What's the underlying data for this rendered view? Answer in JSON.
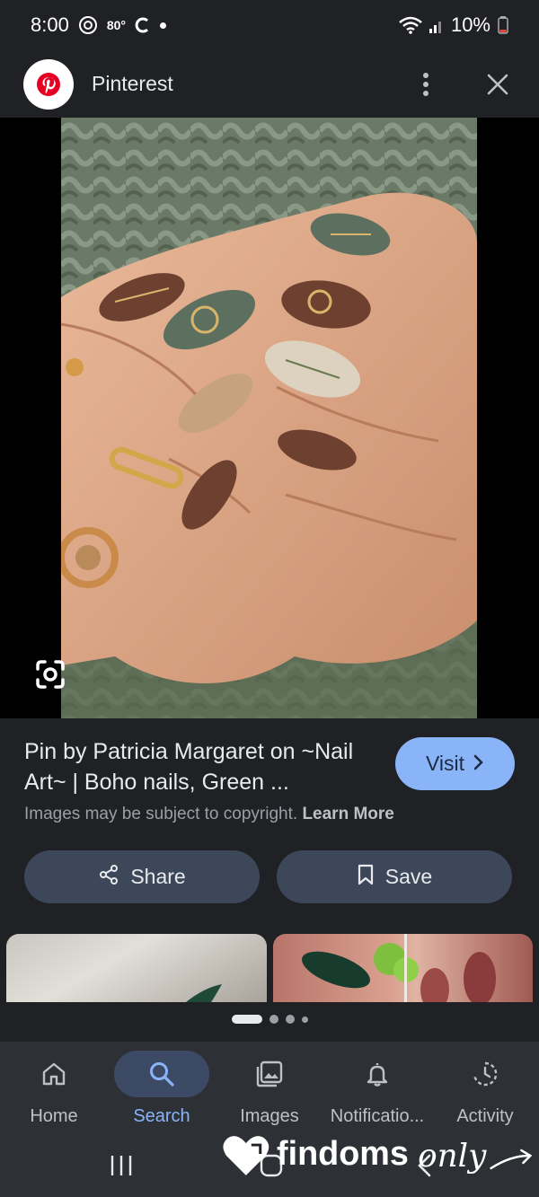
{
  "status_bar": {
    "time": "8:00",
    "temperature": "80°",
    "battery": "10%",
    "icons": [
      "android-auto-icon",
      "weather-icon",
      "c-app-icon",
      "notification-dot",
      "wifi-icon",
      "signal-icon",
      "battery-icon"
    ]
  },
  "app_bar": {
    "title": "Pinterest",
    "logo_icon": "pinterest-logo-icon",
    "actions": [
      "more-vert-icon",
      "close-icon"
    ]
  },
  "image": {
    "lens_icon": "google-lens-icon"
  },
  "pin": {
    "title": "Pin by Patricia Margaret on ~Nail Art~ | Boho nails, Green ...",
    "visit_label": "Visit",
    "copyright_text": "Images may be subject to copyright.",
    "learn_more_label": "Learn More"
  },
  "actions": {
    "share_label": "Share",
    "save_label": "Save"
  },
  "pager": {
    "pages": 4,
    "active": 0
  },
  "bottom_nav": {
    "items": [
      {
        "label": "Home",
        "icon": "home-icon"
      },
      {
        "label": "Search",
        "icon": "search-icon"
      },
      {
        "label": "Images",
        "icon": "images-icon"
      },
      {
        "label": "Notificatio...",
        "icon": "bell-icon"
      },
      {
        "label": "Activity",
        "icon": "activity-icon"
      }
    ],
    "active_index": 1
  },
  "system_nav": [
    "recents-icon",
    "home-button-icon",
    "back-icon"
  ],
  "watermark": {
    "brand_logo": "findoms-only"
  },
  "colors": {
    "background": "#202124",
    "accent": "#8ab4f8",
    "button_bg": "#3c4759",
    "nav_bg": "#2d3035"
  }
}
